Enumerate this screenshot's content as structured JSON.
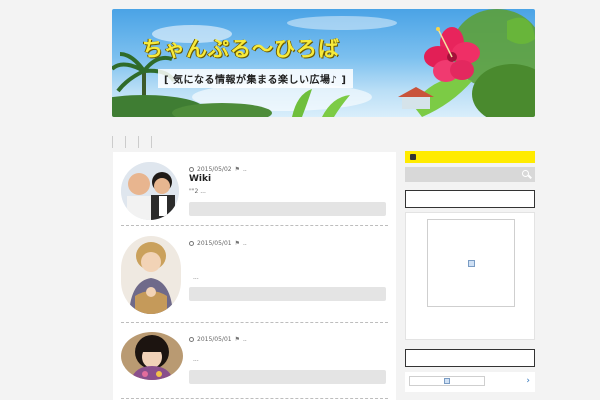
{
  "header": {
    "site_title": "ちゃんぷる〜ひろば",
    "tagline": "[ 気になる情報が集まる楽しい広場♪ ]"
  },
  "posts": [
    {
      "date": "2015/05/02",
      "tag": "..",
      "title": "Wiki",
      "excerpt": "\"\"2 ..."
    },
    {
      "date": "2015/05/01",
      "tag": "..",
      "title": "",
      "excerpt": "..."
    },
    {
      "date": "2015/05/01",
      "tag": "..",
      "title": "",
      "excerpt": "..."
    }
  ],
  "sidebar": {
    "rss_icon": "rss-icon",
    "search_icon": "search-icon",
    "next_icon": "chevron-right-icon"
  },
  "colors": {
    "rss_bar": "#ffeb00",
    "page_bg": "#f3f3f3",
    "accent_link": "#2a6fb8"
  }
}
